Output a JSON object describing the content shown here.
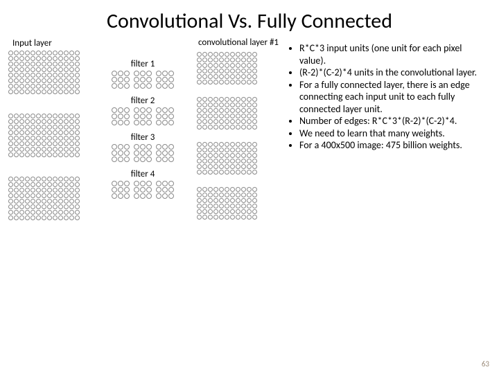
{
  "title": "Convolutional Vs. Fully Connected",
  "labels": {
    "input_layer": "Input layer",
    "conv_layer": "convolutional layer #1",
    "filter1": "filter 1",
    "filter2": "filter 2",
    "filter3": "filter 3",
    "filter4": "filter 4"
  },
  "grids": {
    "input": {
      "rows": 8,
      "cols": 13,
      "copies": 3
    },
    "conv": {
      "rows": 6,
      "cols": 11,
      "copies": 4
    },
    "filter": {
      "rows": 3,
      "cols": 3,
      "copies_per_row": 3,
      "groups": 4
    }
  },
  "bullets": [
    "R*C*3 input units (one unit for each pixel value).",
    "(R-2)*(C-2)*4 units in the convolutional layer.",
    "For a fully connected layer, there is an edge connecting each input unit to each fully connected layer unit.",
    "Number of edges: R*C*3*(R-2)*(C-2)*4.",
    "We need to learn that many weights.",
    "For a 400x500 image: 475 billion weights."
  ],
  "page_number": "63"
}
